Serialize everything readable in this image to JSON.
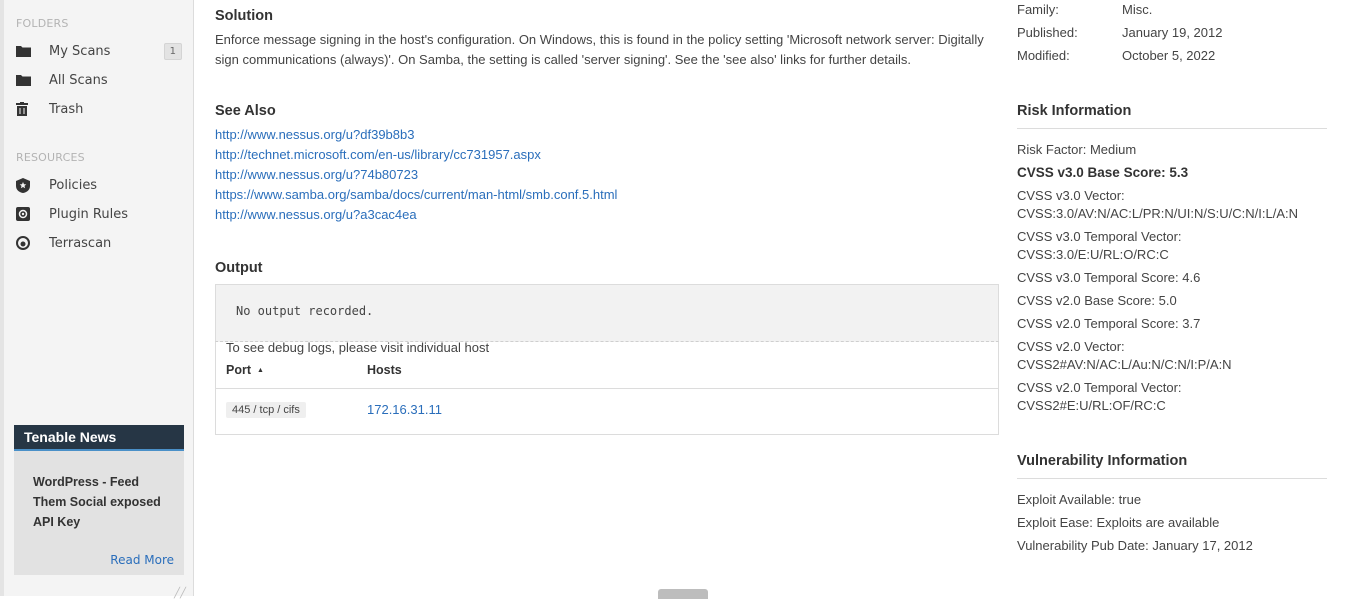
{
  "sidebar": {
    "folders_heading": "FOLDERS",
    "folders": [
      {
        "label": "My Scans",
        "count": "1",
        "icon": "folder-icon"
      },
      {
        "label": "All Scans",
        "icon": "folder-icon"
      },
      {
        "label": "Trash",
        "icon": "trash-icon"
      }
    ],
    "resources_heading": "RESOURCES",
    "resources": [
      {
        "label": "Policies",
        "icon": "policy-shield-icon"
      },
      {
        "label": "Plugin Rules",
        "icon": "plugin-rules-icon"
      },
      {
        "label": "Terrascan",
        "icon": "terrascan-icon"
      }
    ],
    "news": {
      "heading": "Tenable News",
      "title": "WordPress - Feed Them Social exposed API Key",
      "read_more": "Read More"
    }
  },
  "main": {
    "solution_title": "Solution",
    "solution_text": "Enforce message signing in the host's configuration. On Windows, this is found in the policy setting 'Microsoft network server: Digitally sign communications (always)'. On Samba, the setting is called 'server signing'. See the 'see also' links for further details.",
    "see_also_title": "See Also",
    "see_also": [
      "http://www.nessus.org/u?df39b8b3",
      "http://technet.microsoft.com/en-us/library/cc731957.aspx",
      "http://www.nessus.org/u?74b80723",
      "https://www.samba.org/samba/docs/current/man-html/smb.conf.5.html",
      "http://www.nessus.org/u?a3cac4ea"
    ],
    "output_title": "Output",
    "output_text": "No output recorded.",
    "debug_note": "To see debug logs, please visit individual host",
    "table": {
      "port_header": "Port",
      "hosts_header": "Hosts",
      "rows": [
        {
          "port": "445 / tcp / cifs",
          "host": "172.16.31.11"
        }
      ]
    }
  },
  "details": {
    "family_label": "Family:",
    "family_value": "Misc.",
    "published_label": "Published:",
    "published_value": "January 19, 2012",
    "modified_label": "Modified:",
    "modified_value": "October 5, 2022"
  },
  "risk": {
    "title": "Risk Information",
    "risk_factor": "Risk Factor: Medium",
    "cvss3_base": "CVSS v3.0 Base Score: 5.3",
    "cvss3_vector_label": "CVSS v3.0 Vector:",
    "cvss3_vector": "CVSS:3.0/AV:N/AC:L/PR:N/UI:N/S:U/C:N/I:L/A:N",
    "cvss3_temporal_vector_label": "CVSS v3.0 Temporal Vector:",
    "cvss3_temporal_vector": "CVSS:3.0/E:U/RL:O/RC:C",
    "cvss3_temporal_score": "CVSS v3.0 Temporal Score: 4.6",
    "cvss2_base": "CVSS v2.0 Base Score: 5.0",
    "cvss2_temporal_score": "CVSS v2.0 Temporal Score: 3.7",
    "cvss2_vector_label": "CVSS v2.0 Vector:",
    "cvss2_vector": "CVSS2#AV:N/AC:L/Au:N/C:N/I:P/A:N",
    "cvss2_temporal_vector_label": "CVSS v2.0 Temporal Vector:",
    "cvss2_temporal_vector": "CVSS2#E:U/RL:OF/RC:C"
  },
  "vuln": {
    "title": "Vulnerability Information",
    "exploit_available": "Exploit Available: true",
    "exploit_ease": "Exploit Ease: Exploits are available",
    "pub_date": "Vulnerability Pub Date: January 17, 2012"
  }
}
